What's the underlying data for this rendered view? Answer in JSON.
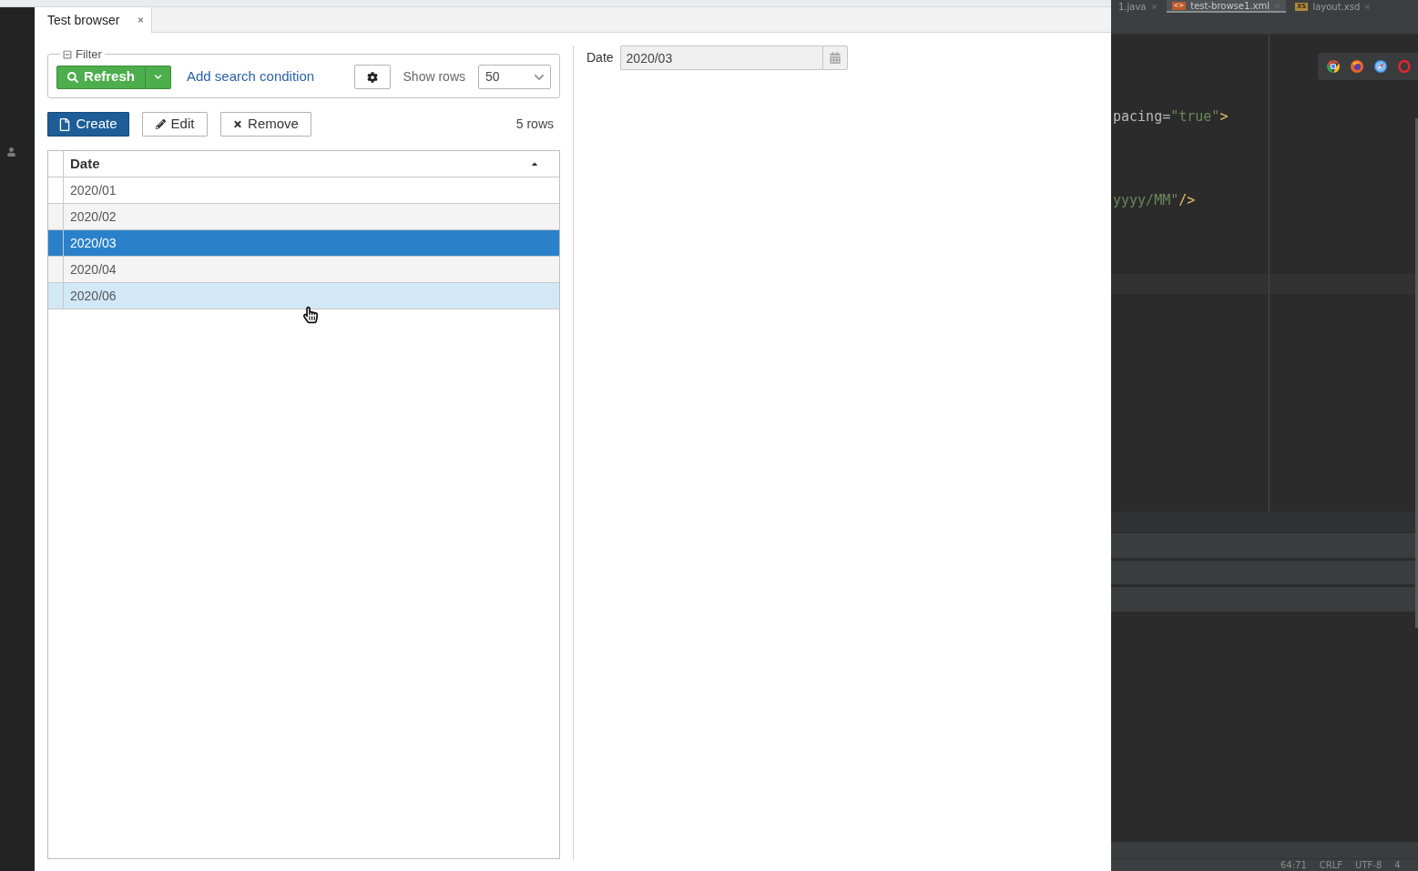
{
  "tabs": [
    {
      "label": "Test browser",
      "selected": true
    }
  ],
  "filter": {
    "legend": "Filter",
    "expanded": true,
    "refresh_button": "Refresh",
    "add_condition_link": "Add search condition",
    "show_rows_label": "Show rows",
    "show_rows_value": "50"
  },
  "actions": [
    {
      "kind": "create",
      "label": "Create"
    },
    {
      "kind": "edit",
      "label": "Edit"
    },
    {
      "kind": "remove",
      "label": "Remove"
    }
  ],
  "row_count": "5 rows",
  "table": {
    "columns": [
      {
        "label": "Date",
        "sorted_ascending": true
      }
    ],
    "rows": [
      {
        "cells": [
          "2020/01"
        ],
        "selected": false,
        "hovered": false
      },
      {
        "cells": [
          "2020/02"
        ],
        "selected": false,
        "hovered": false
      },
      {
        "cells": [
          "2020/03"
        ],
        "selected": true,
        "hovered": false
      },
      {
        "cells": [
          "2020/04"
        ],
        "selected": false,
        "hovered": false
      },
      {
        "cells": [
          "2020/06"
        ],
        "selected": false,
        "hovered": true
      }
    ]
  },
  "editor": {
    "label": "Date",
    "value": "2020/03"
  },
  "ide": {
    "tabs": [
      {
        "label": "1.java",
        "selected": false
      },
      {
        "label": "test-browse1.xml",
        "selected": true,
        "badge": "<>",
        "kind": "xml"
      },
      {
        "label": "layout.xsd",
        "selected": false,
        "badge": "XS",
        "kind": "xsd"
      }
    ],
    "code_lines": [
      [
        {
          "kind": "attr",
          "text": "pacing"
        },
        {
          "kind": "punct",
          "text": "="
        },
        {
          "kind": "string",
          "text": "\"true\""
        },
        {
          "kind": "tag",
          "text": ">"
        }
      ],
      [
        {
          "kind": "string",
          "text": "yyyy/MM\""
        },
        {
          "kind": "tag",
          "text": "/>"
        }
      ]
    ],
    "status_bar": [
      "64:71",
      "CRLF",
      "UTF-8",
      "4"
    ]
  }
}
